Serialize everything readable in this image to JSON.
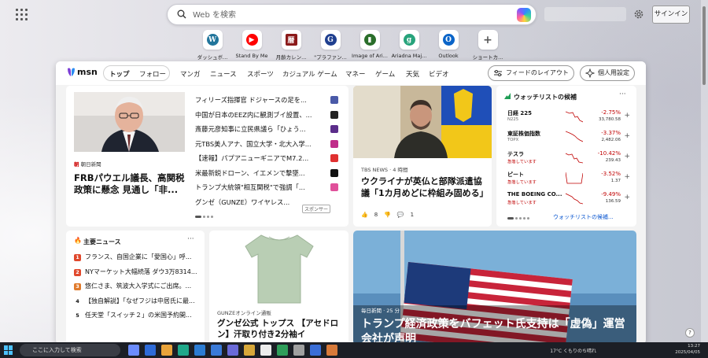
{
  "search": {
    "placeholder": "Web を検索"
  },
  "header": {
    "signin_label": "サインイン"
  },
  "quick_links": [
    {
      "label": "ダッシュボ...",
      "icon": "wordpress-icon",
      "color": "#21759b"
    },
    {
      "label": "Stand By Me",
      "icon": "youtube-icon",
      "color": "#ff0000"
    },
    {
      "label": "月齢カレン...",
      "icon": "calendar-kanji-icon",
      "color": "#8b1a1a"
    },
    {
      "label": "\"プラファン...",
      "icon": "g-logo-icon",
      "color": "#1f3f8f"
    },
    {
      "label": "Image of Ari...",
      "icon": "painting-icon",
      "color": "#2a6e2a"
    },
    {
      "label": "Ariadna Maj...",
      "icon": "g-circle-icon",
      "color": "#27a37b"
    },
    {
      "label": "Outlook",
      "icon": "outlook-icon",
      "color": "#0a64c8"
    },
    {
      "label": "ショートカ...",
      "icon": "plus-icon",
      "color": "#555555"
    }
  ],
  "nav": {
    "brand": "msn",
    "tabs": [
      "トップ",
      "フォロー",
      "マンガ",
      "ニュース",
      "スポーツ",
      "カジュアル ゲーム",
      "マネー",
      "ゲーム",
      "天気",
      "ビデオ"
    ],
    "more": "···",
    "layout_button": "フィードのレイアウト",
    "personal_button": "個人用設定"
  },
  "hero": {
    "source": "朝日新聞",
    "title": "FRBパウエル議長、高関税政策に懸念 見通し「非..."
  },
  "headlines": [
    {
      "text": "フィリーズ指揮官 ドジャースの足を...",
      "badge_color": "#4a5aa8"
    },
    {
      "text": "中国が日本のEEZ内に観測ブイ設置、...",
      "badge_color": "#222222"
    },
    {
      "text": "斎藤元彦知事に立民県議ら「ひょう...",
      "badge_color": "#5b2d8a"
    },
    {
      "text": "元TBS美人アナ、国立大学・北大入学...",
      "badge_color": "#c02c8a"
    },
    {
      "text": "【速報】パプアニューギニアでM7.2...",
      "badge_color": "#e03030"
    },
    {
      "text": "米最新鋭ドローン、イエメンで撃墜...",
      "badge_color": "#111111"
    },
    {
      "text": "トランプ大統領\"相互関税\"で強調「...",
      "badge_color": "#e0509a"
    },
    {
      "text": "グンゼ（GUNZE）ワイヤレス...",
      "badge_color": "#ffffff"
    }
  ],
  "sponsor_label": "スポンサー",
  "ukraine": {
    "source": "TBS NEWS · 4 時間",
    "title": "ウクライナが英仏と部隊派遣協議「1カ月めどに枠組み固める」",
    "likes": "8",
    "comments": "1"
  },
  "watchlist": {
    "title": "ウォッチリストの候補",
    "footer": "ウォッチリストの候補...",
    "items": [
      {
        "name": "日経 225",
        "sub": "N225",
        "pct": "-2.75%",
        "value": "33,780.58"
      },
      {
        "name": "東証株価指数",
        "sub": "TOPX",
        "pct": "-3.37%",
        "value": "2,482.06"
      },
      {
        "name": "テスラ",
        "sub": "急落しています",
        "pct": "-10.42%",
        "value": "239.43"
      },
      {
        "name": "ピート",
        "sub": "急落しています",
        "pct": "-3.52%",
        "value": "1.37"
      },
      {
        "name": "THE BOEING CO...",
        "sub": "急落しています",
        "pct": "-9.49%",
        "value": "136.59"
      }
    ]
  },
  "top_news": {
    "title": "主要ニュース",
    "items": [
      {
        "num": "1",
        "text": "フランス、自国企業に「愛国心」呼...",
        "color": "#e0482c"
      },
      {
        "num": "2",
        "text": "NYマーケット大幅続落 ダウ3万8314...",
        "color": "#e0482c"
      },
      {
        "num": "3",
        "text": "悠仁さま、筑波大入学式にご出席。...",
        "color": "#e07a2c"
      },
      {
        "num": "4",
        "text": "【独自解説】「なぜフジは中居氏に最...",
        "color": "#ffffff"
      },
      {
        "num": "5",
        "text": "任天堂「スイッチ２」の米国予約開...",
        "color": "#ffffff"
      }
    ]
  },
  "gunze": {
    "source": "GUNZEオンライン通販",
    "title": "グンゼ公式 トップス 【アセドロン】汗取り付き2分袖イ"
  },
  "trump": {
    "source": "毎日新聞 · 25 分",
    "title": "トランプ経済政策をバフェット氏支持は「虚偽」運営会社が声明"
  },
  "taskbar": {
    "search_placeholder": "ここに入力して検索",
    "weather": "17°C くもりのち晴れ",
    "time": "13:27",
    "date": "2025/04/05"
  }
}
